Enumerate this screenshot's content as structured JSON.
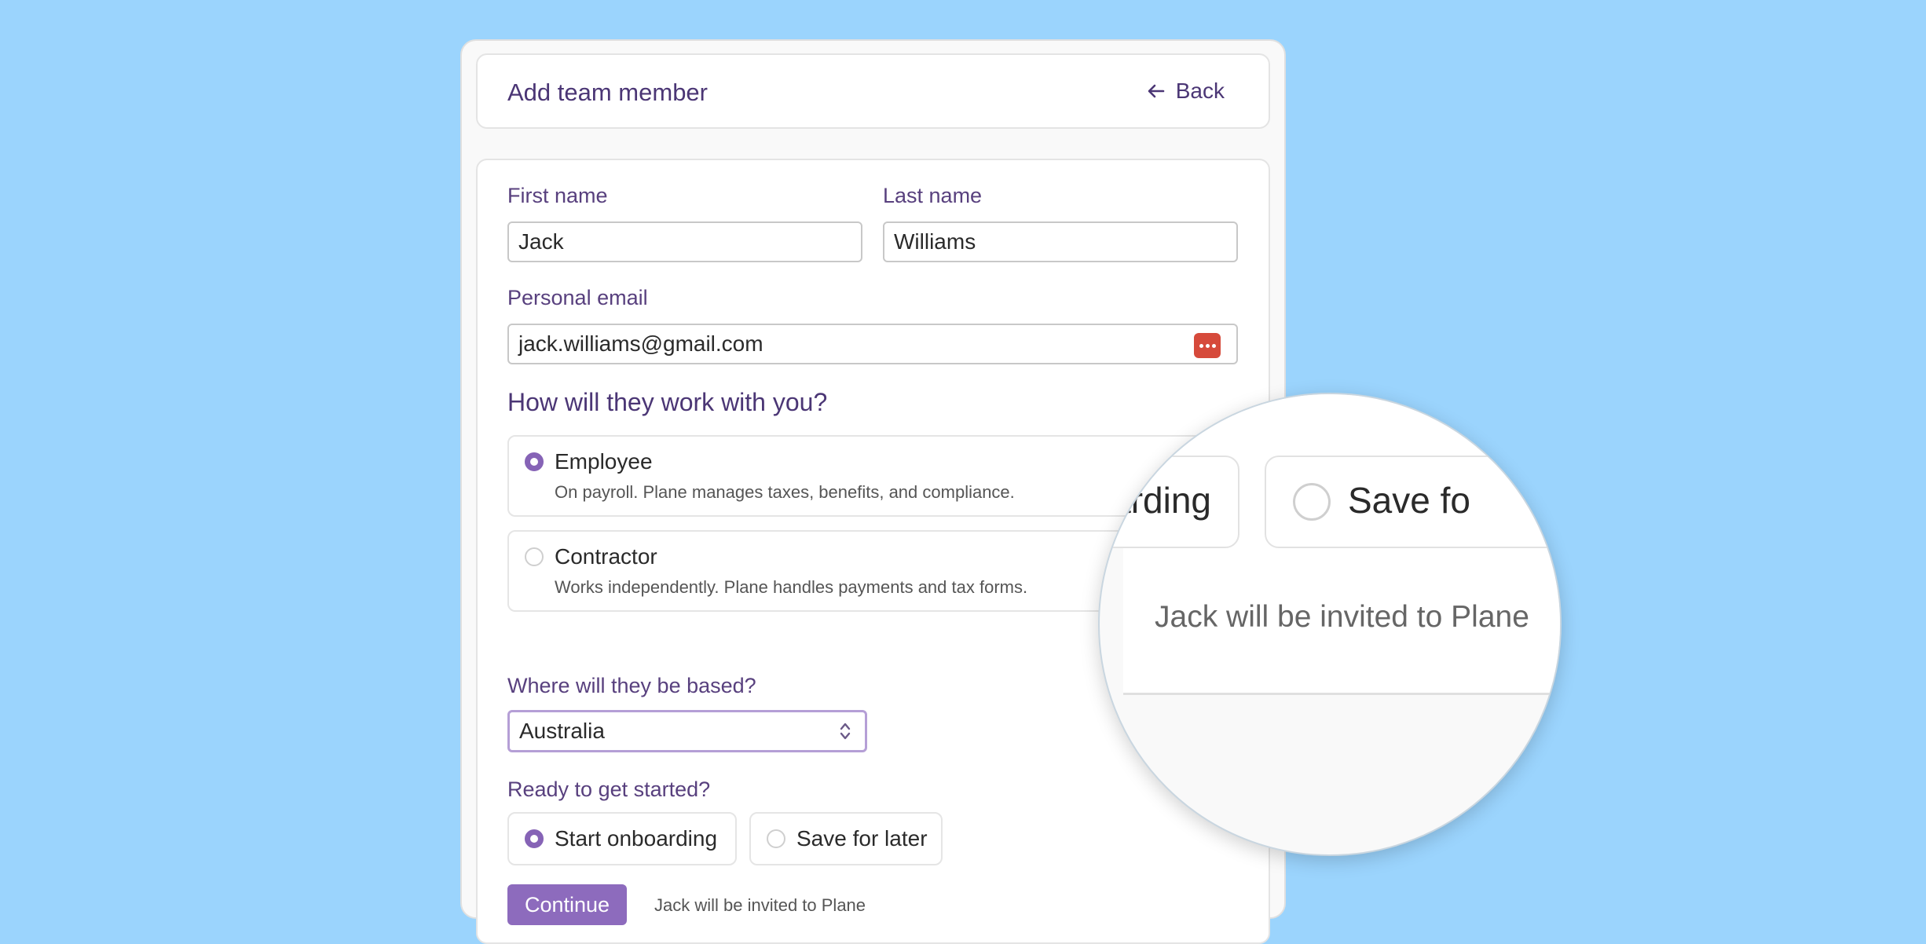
{
  "header": {
    "title": "Add team member",
    "back_label": "Back"
  },
  "form": {
    "first_name": {
      "label": "First name",
      "value": "Jack"
    },
    "last_name": {
      "label": "Last name",
      "value": "Williams"
    },
    "email": {
      "label": "Personal email",
      "value": "jack.williams@gmail.com"
    },
    "work_type": {
      "question": "How will they work with you?",
      "options": [
        {
          "title": "Employee",
          "description": "On payroll. Plane manages taxes, benefits, and compliance.",
          "selected": true
        },
        {
          "title": "Contractor",
          "description": "Works independently. Plane handles payments and tax forms.",
          "selected": false
        }
      ]
    },
    "location": {
      "label": "Where will they be based?",
      "value": "Australia"
    },
    "ready": {
      "question": "Ready to get started?",
      "options": [
        {
          "label": "Start onboarding",
          "selected": true
        },
        {
          "label": "Save for later",
          "selected": false
        }
      ]
    },
    "continue_label": "Continue",
    "hint": "Jack will be invited to Plane"
  },
  "magnifier": {
    "left_fragment": "boarding",
    "right_fragment": "Save fo",
    "hint": "Jack will be invited to Plane"
  },
  "colors": {
    "accent": "#8663b6",
    "heading": "#4b3675",
    "background": "#9bd4fd",
    "password_icon": "#d64a3b"
  }
}
